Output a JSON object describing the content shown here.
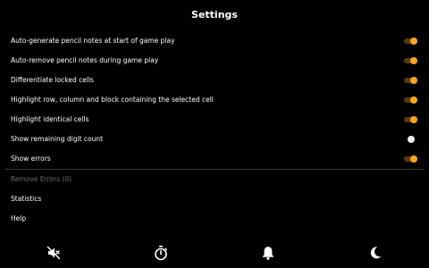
{
  "header": {
    "title": "Settings"
  },
  "settings": [
    {
      "label": "Auto-generate pencil notes at start of game play",
      "enabled": true
    },
    {
      "label": "Auto-remove pencil notes during game play",
      "enabled": true
    },
    {
      "label": "Differentiate locked cells",
      "enabled": true
    },
    {
      "label": "Highlight row, column and block containing the selected cell",
      "enabled": true
    },
    {
      "label": "Highlight identical cells",
      "enabled": true
    },
    {
      "label": "Show remaining digit count",
      "enabled": false
    },
    {
      "label": "Show errors",
      "enabled": true
    }
  ],
  "menu": {
    "remove_errors": "Remove Errors (0)",
    "statistics": "Statistics",
    "help": "Help"
  },
  "bottom_bar": {
    "icons": [
      "sound-off-icon",
      "timer-icon",
      "bell-icon",
      "moon-icon"
    ]
  },
  "colors": {
    "accent": "#f6a623",
    "background": "#000000",
    "disabled_text": "#6f6f6f"
  }
}
